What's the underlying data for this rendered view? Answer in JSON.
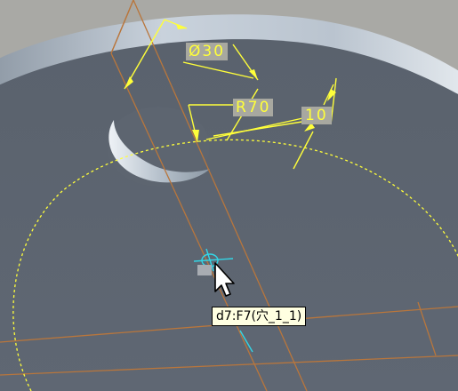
{
  "viewport": {
    "name": "3d-model-view",
    "colors": {
      "background": "#a9a9a5",
      "part_face": "#5d6570",
      "part_rim": "#c2ccd6",
      "sketch_yellow": "#ffff3a",
      "datum_orange": "#b9763c",
      "axis_cyan": "#33d6e6"
    }
  },
  "dimensions": {
    "diameter": "Ø30",
    "radius": "R70",
    "distance": "10"
  },
  "tooltip": {
    "text": "d7:F7(穴_1_1)"
  },
  "cursor": {
    "icon": "arrow-cursor-icon"
  }
}
